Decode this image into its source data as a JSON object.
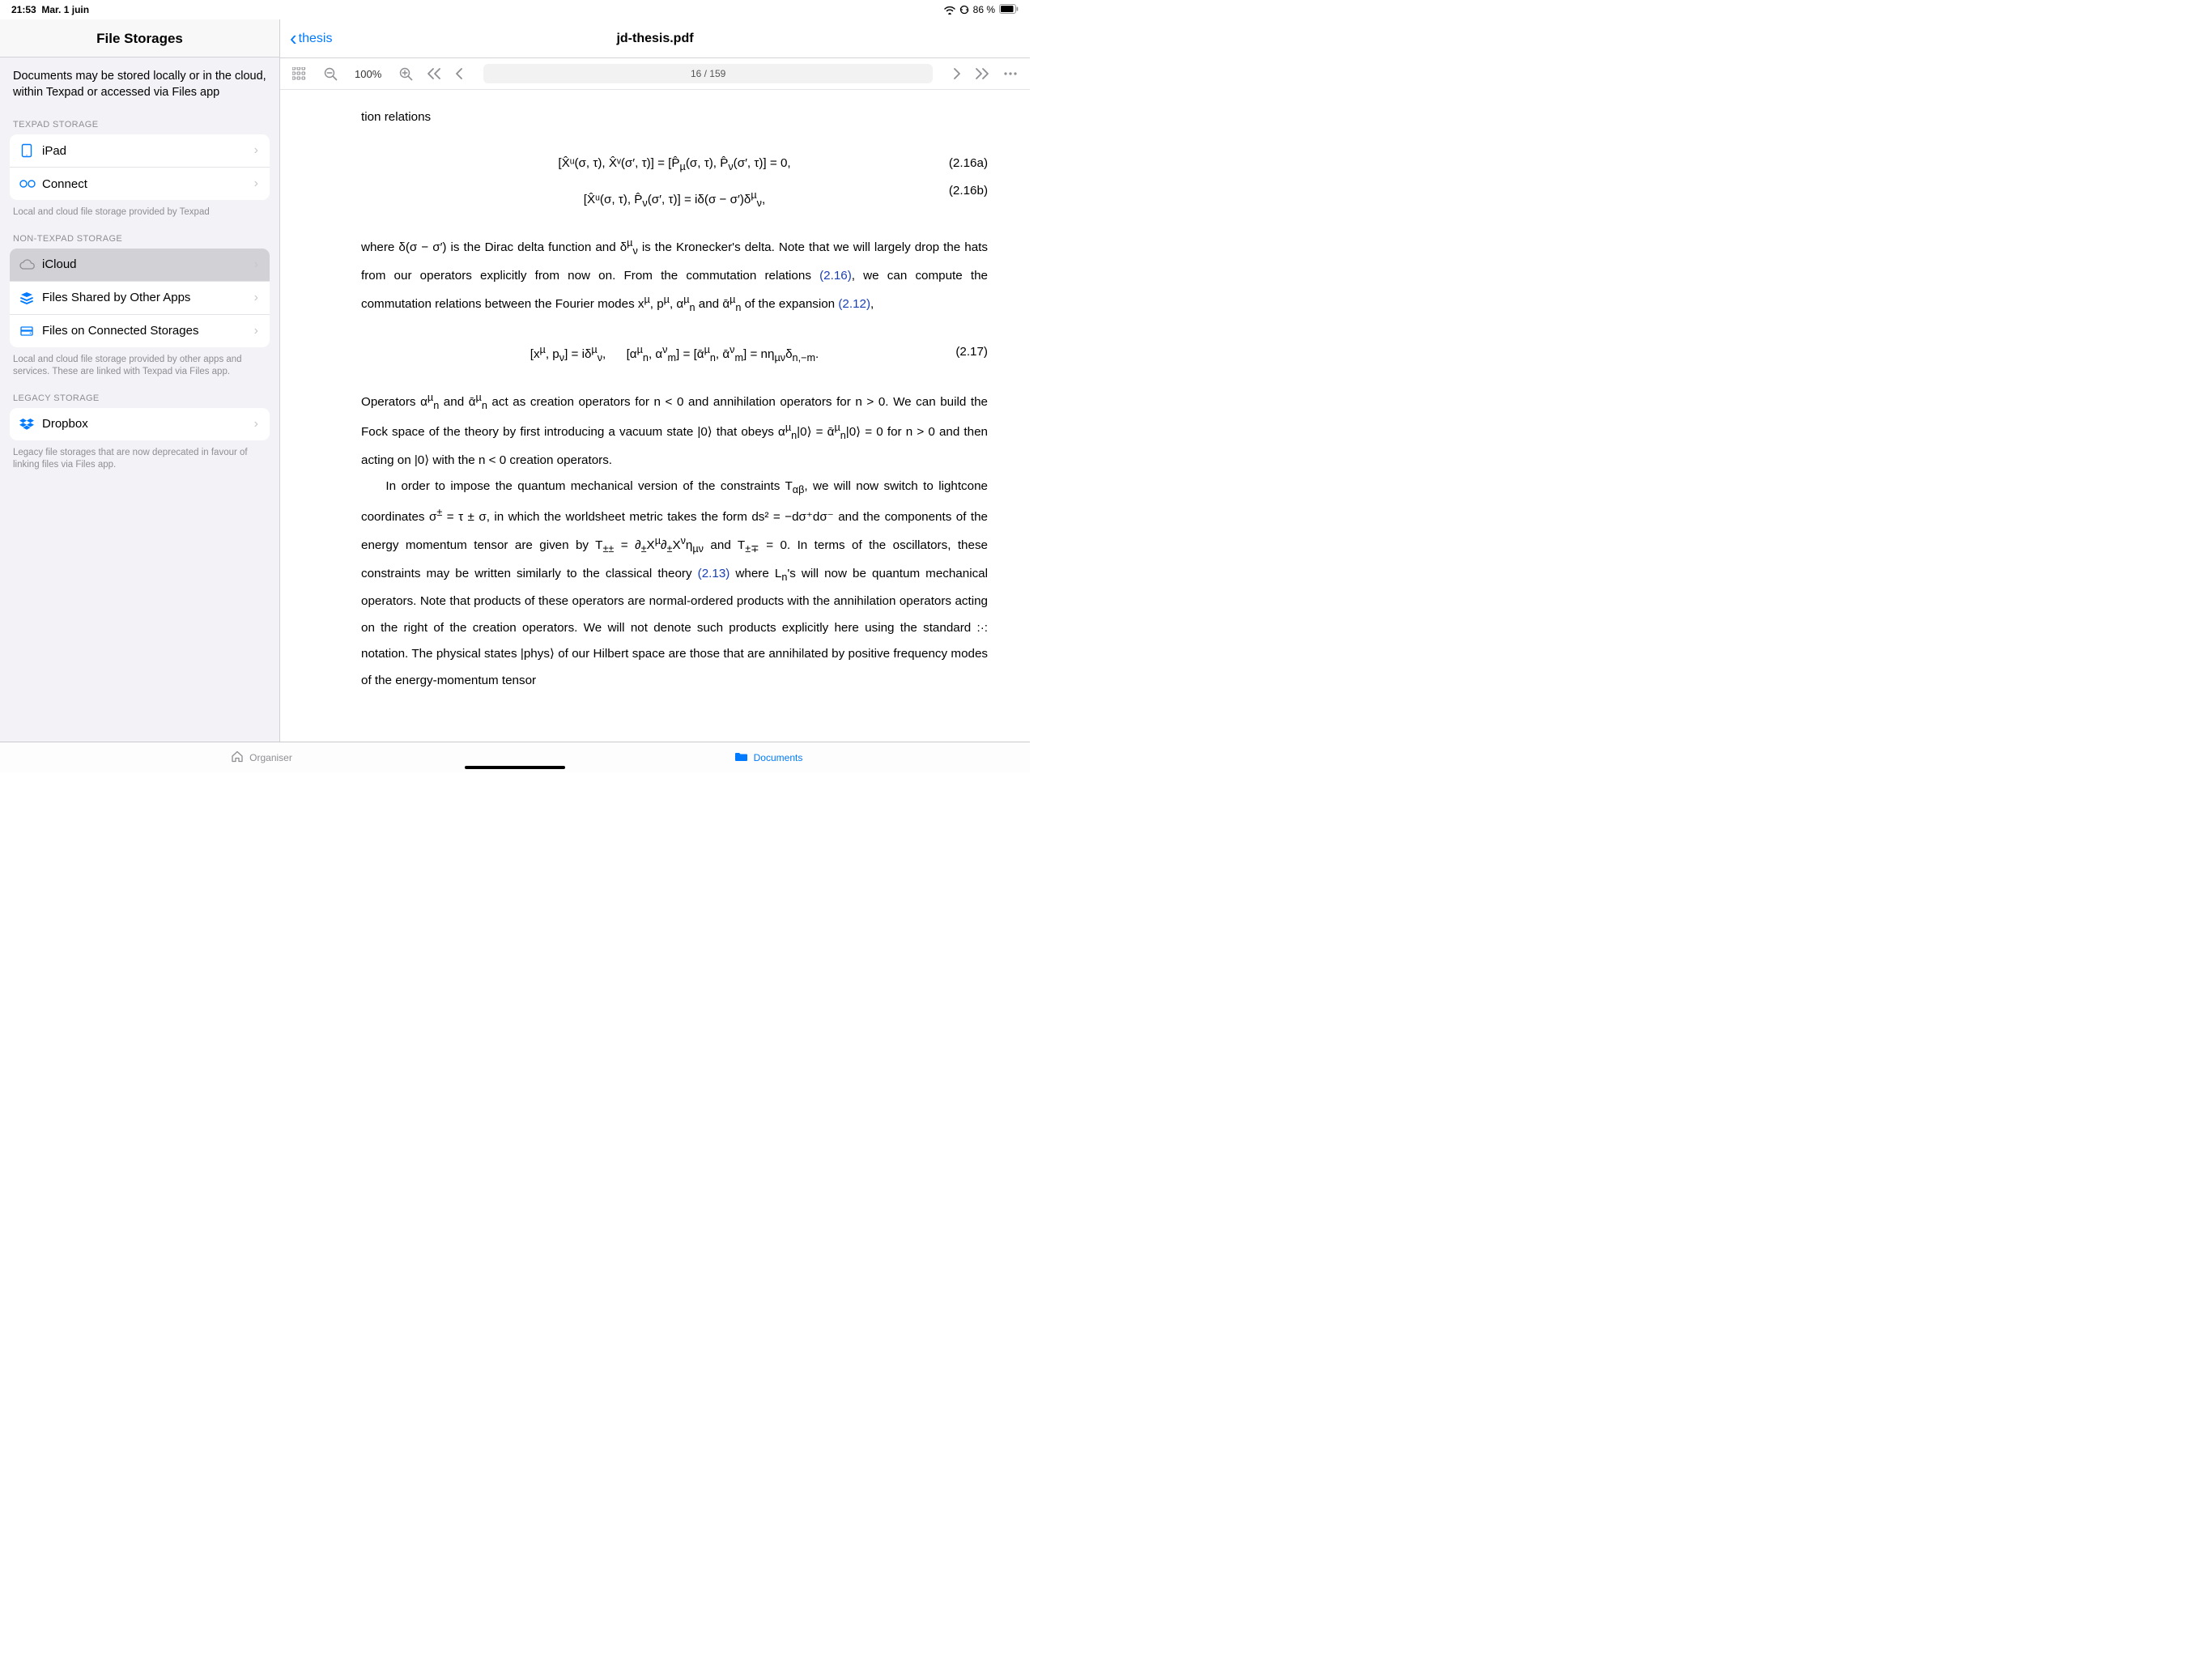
{
  "status": {
    "time": "21:53",
    "date": "Mar. 1 juin",
    "battery": "86 %"
  },
  "sidebar": {
    "title": "File Storages",
    "descriptor": "Documents may be stored locally or in the cloud, within Texpad or accessed via Files app",
    "section_texpad": "TEXPAD STORAGE",
    "items_texpad": [
      {
        "label": "iPad"
      },
      {
        "label": "Connect"
      }
    ],
    "footer_texpad": "Local and cloud file storage provided by Texpad",
    "section_non": "NON-TEXPAD STORAGE",
    "items_non": [
      {
        "label": "iCloud"
      },
      {
        "label": "Files Shared by Other Apps"
      },
      {
        "label": "Files on Connected Storages"
      }
    ],
    "footer_non": "Local and cloud file storage provided by other apps and services. These are linked with Texpad via Files app.",
    "section_legacy": "LEGACY STORAGE",
    "items_legacy": [
      {
        "label": "Dropbox"
      }
    ],
    "footer_legacy": "Legacy file storages that are now deprecated in favour of linking files via Files app."
  },
  "content_header": {
    "back_label": "thesis",
    "doc_title": "jd-thesis.pdf"
  },
  "toolbar": {
    "zoom": "100%",
    "page_indicator": "16 / 159"
  },
  "tabbar": {
    "left": "Organiser",
    "right": "Documents"
  },
  "pdf": {
    "frag_top": "tion relations",
    "eq_a": "[X̂ᵘ(σ, τ), X̂ᵛ(σ′, τ)] = [P̂<sub>µ</sub>(σ, τ), P̂<sub>ν</sub>(σ′, τ)] = 0,",
    "eq_a_num": "(2.16a)",
    "eq_b": "[X̂ᵘ(σ, τ), P̂<sub>ν</sub>(σ′, τ)] = iδ(σ − σ′)δ<sup>µ</sup><sub>ν</sub>,",
    "eq_b_num": "(2.16b)",
    "para1_a": "where δ(σ − σ′) is the Dirac delta function and δ<sup>µ</sup><sub>ν</sub> is the Kronecker's delta.  Note that we will largely drop the hats from our operators explicitly from now on. From the commutation relations ",
    "ref_216": "(2.16)",
    "para1_b": ", we can compute the commutation relations between the Fourier modes x<sup>µ</sup>, p<sup>µ</sup>, α<sup>µ</sup><sub>n</sub> and ᾱ<sup>µ</sup><sub>n</sub> of the expansion ",
    "ref_212": "(2.12)",
    "para1_c": ",",
    "eq_217": "[x<sup>µ</sup>, p<sub>ν</sub>] = iδ<sup>µ</sup><sub>ν</sub>,&nbsp;&nbsp;&nbsp;&nbsp;&nbsp;&nbsp;[α<sup>µ</sup><sub>n</sub>, α<sup>ν</sup><sub>m</sub>] = [ᾱ<sup>µ</sup><sub>n</sub>, ᾱ<sup>ν</sup><sub>m</sub>] = nη<sub>µν</sub>δ<sub>n,−m</sub>.",
    "eq_217_num": "(2.17)",
    "para2": "Operators α<sup>µ</sup><sub>n</sub> and ᾱ<sup>µ</sup><sub>n</sub> act as creation operators for n < 0 and annihilation operators for n > 0. We can build the Fock space of the theory by first introducing a vacuum state |0⟩ that obeys α<sup>µ</sup><sub>n</sub>|0⟩ = ᾱ<sup>µ</sup><sub>n</sub>|0⟩ = 0 for n > 0 and then acting on |0⟩ with the n < 0 creation operators.",
    "para3_a": "In order to impose the quantum mechanical version of the constraints T<sub>αβ</sub>, we will now switch to lightcone coordinates σ<sup>±</sup> = τ ± σ, in which the worldsheet metric takes the form ds² = −dσ⁺dσ⁻ and the components of the energy momentum tensor are given by T<sub>±±</sub> = ∂<sub>±</sub>X<sup>µ</sup>∂<sub>±</sub>X<sup>ν</sup>η<sub>µν</sub> and T<sub>±∓</sub> = 0. In terms of the oscillators, these constraints may be written sim­ilarly to the classical theory ",
    "ref_213": "(2.13)",
    "para3_b": " where L<sub>n</sub>'s will now be quantum mechanical operators. Note that products of these operators are normal-ordered products with the annihilation operators acting on the right of the creation operators.  We will not denote such products explicitly here using the standard :·: notation. The physical states |phys⟩ of our Hilbert space are those that are annihilated by positive frequency modes of the energy-momentum tensor"
  }
}
